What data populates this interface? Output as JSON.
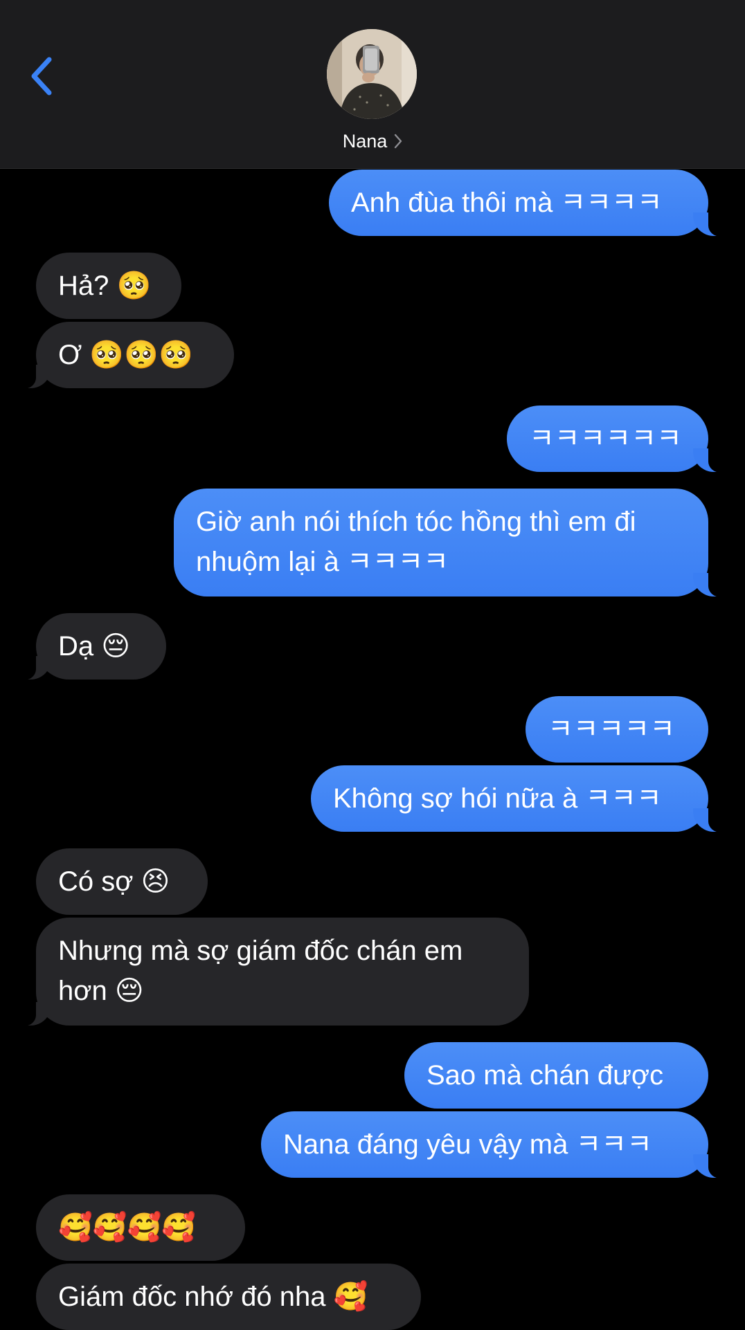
{
  "header": {
    "contact_name": "Nana",
    "back_icon": "chevron-left-icon",
    "detail_icon": "chevron-right-icon",
    "accent_color": "#3a82f6"
  },
  "messages": [
    {
      "side": "sent",
      "text": "Anh đùa thôi mà ㅋㅋㅋㅋ"
    },
    {
      "side": "received",
      "text": "Hả? 🥺"
    },
    {
      "side": "received",
      "text": "Ơ 🥺🥺🥺"
    },
    {
      "side": "sent",
      "text": "ㅋㅋㅋㅋㅋㅋ"
    },
    {
      "side": "sent",
      "text": "Giờ anh nói thích tóc hồng thì em đi nhuộm lại à ㅋㅋㅋㅋ"
    },
    {
      "side": "received",
      "text": "Dạ 😔"
    },
    {
      "side": "sent",
      "text": "ㅋㅋㅋㅋㅋ"
    },
    {
      "side": "sent",
      "text": "Không sợ hói nữa à ㅋㅋㅋ"
    },
    {
      "side": "received",
      "text": "Có sợ 😣"
    },
    {
      "side": "received",
      "text": "Nhưng mà sợ giám đốc chán em hơn 😔"
    },
    {
      "side": "sent",
      "text": "Sao mà chán được"
    },
    {
      "side": "sent",
      "text": "Nana đáng yêu vậy mà ㅋㅋㅋ"
    },
    {
      "side": "received",
      "text": "🥰🥰🥰🥰"
    },
    {
      "side": "received",
      "text": "Giám đốc nhớ đó nha 🥰"
    }
  ]
}
